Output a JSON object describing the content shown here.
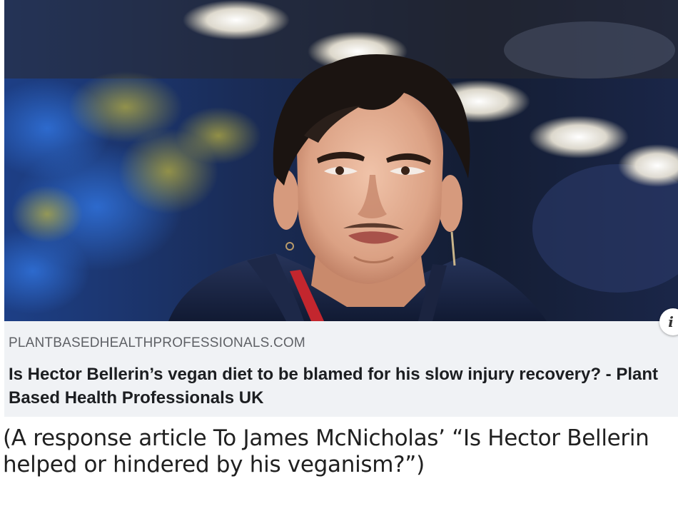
{
  "link_preview": {
    "image": {
      "alt": "Hector Bellerin",
      "icon": "info-icon",
      "info_glyph": "i"
    },
    "domain": "PLANTBASEDHEALTHPROFESSIONALS.COM",
    "headline": "Is Hector Bellerin’s vegan diet to be blamed for his slow injury recovery? - Plant Based Health Professionals UK"
  },
  "caption": "(A response article To James McNicholas’ “Is Hector Bellerin helped or hindered by his veganism?”)",
  "colors": {
    "card_background": "#f0f2f5",
    "domain_text": "#5f6166",
    "headline_text": "#1c1e21",
    "caption_text": "#202020"
  }
}
